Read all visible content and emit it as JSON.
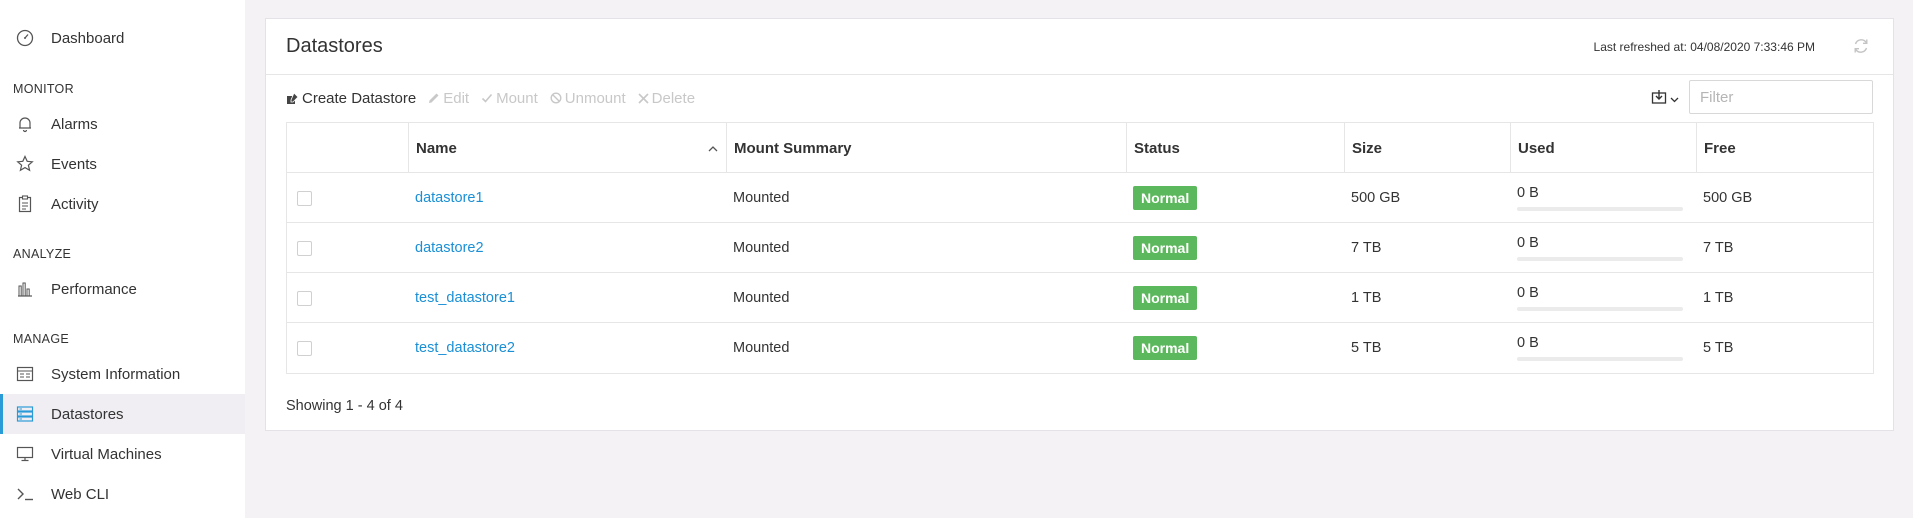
{
  "sidebar": {
    "dashboard": "Dashboard",
    "sections": {
      "monitor": "MONITOR",
      "analyze": "ANALYZE",
      "manage": "MANAGE"
    },
    "alarms": "Alarms",
    "events": "Events",
    "activity": "Activity",
    "performance": "Performance",
    "system_information": "System Information",
    "datastores": "Datastores",
    "virtual_machines": "Virtual Machines",
    "web_cli": "Web CLI",
    "active_item": "Datastores"
  },
  "main": {
    "title": "Datastores",
    "last_refreshed": "Last refreshed at: 04/08/2020 7:33:46 PM",
    "toolbar": {
      "create": "Create Datastore",
      "edit": "Edit",
      "mount": "Mount",
      "unmount": "Unmount",
      "delete": "Delete"
    },
    "filter_placeholder": "Filter",
    "table": {
      "columns": [
        "Name",
        "Mount Summary",
        "Status",
        "Size",
        "Used",
        "Free"
      ],
      "sort_column": "Name",
      "rows": [
        {
          "name": "datastore1",
          "mount_summary": "Mounted",
          "status": "Normal",
          "size": "500 GB",
          "used": "0 B",
          "used_fraction": 0,
          "free": "500 GB"
        },
        {
          "name": "datastore2",
          "mount_summary": "Mounted",
          "status": "Normal",
          "size": "7 TB",
          "used": "0 B",
          "used_fraction": 0,
          "free": "7 TB"
        },
        {
          "name": "test_datastore1",
          "mount_summary": "Mounted",
          "status": "Normal",
          "size": "1 TB",
          "used": "0 B",
          "used_fraction": 0,
          "free": "1 TB"
        },
        {
          "name": "test_datastore2",
          "mount_summary": "Mounted",
          "status": "Normal",
          "size": "5 TB",
          "used": "0 B",
          "used_fraction": 0,
          "free": "5 TB"
        }
      ]
    },
    "showing": "Showing 1 - 4 of 4"
  },
  "colors": {
    "accent": "#2b9bd8",
    "link": "#1a8fd6",
    "status_normal": "#5cb85c"
  }
}
